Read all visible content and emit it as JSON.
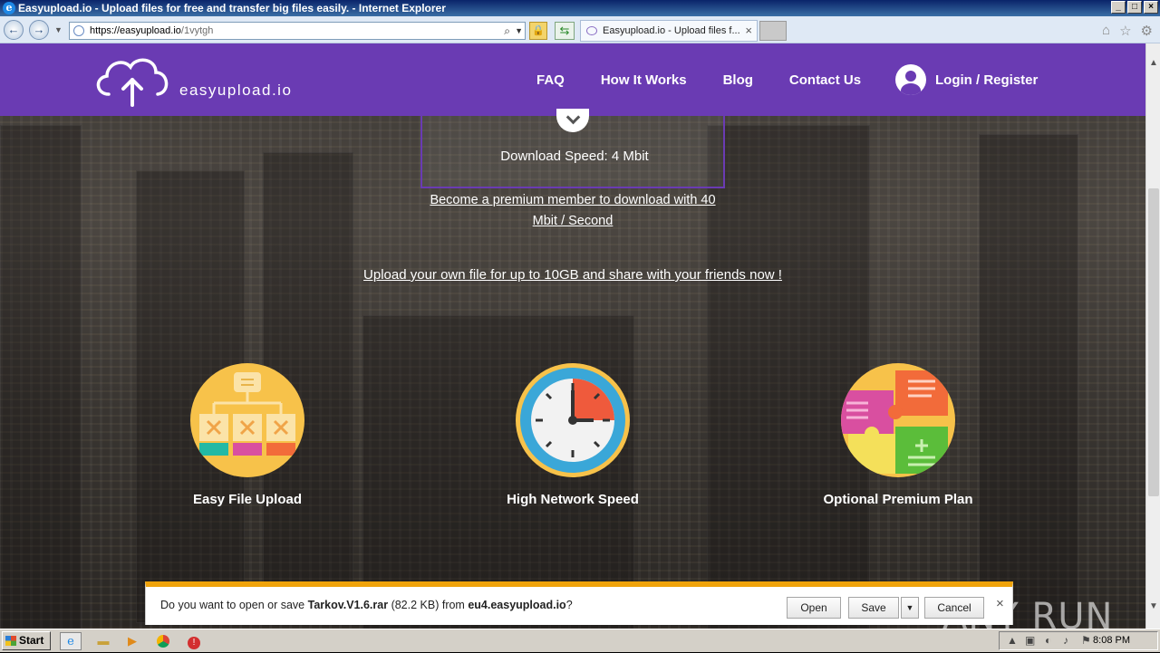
{
  "window": {
    "title": "Easyupload.io - Upload files for free and transfer big files easily. - Internet Explorer"
  },
  "browser": {
    "url_main": "https://easyupload.io",
    "url_path": "/1vytgh",
    "tab_title": "Easyupload.io - Upload files f..."
  },
  "site": {
    "logo_text": "easyupload.io",
    "nav": [
      "FAQ",
      "How It Works",
      "Blog",
      "Contact Us"
    ],
    "login_label": "Login / Register",
    "brand_color": "#6a3bb3"
  },
  "download": {
    "speed": "Download Speed: 4 Mbit",
    "premium_line1": "Become a premium member to download with 40",
    "premium_line2": "Mbit / Second",
    "upload_link": "Upload your own file for up to 10GB and share with your friends now !"
  },
  "features": [
    {
      "label": "Easy File Upload",
      "icon": "flowchart-icon"
    },
    {
      "label": "High Network Speed",
      "icon": "clock-icon"
    },
    {
      "label": "Optional Premium Plan",
      "icon": "puzzle-icon"
    }
  ],
  "download_bar": {
    "prefix": "Do you want to open or save ",
    "filename": "Tarkov.V1.6.rar",
    "size": " (82.2 KB) from ",
    "host": "eu4.easyupload.io",
    "suffix": "?",
    "open": "Open",
    "save": "Save",
    "cancel": "Cancel"
  },
  "watermark": "ANY RUN",
  "taskbar": {
    "start": "Start",
    "clock": "8:08 PM"
  }
}
